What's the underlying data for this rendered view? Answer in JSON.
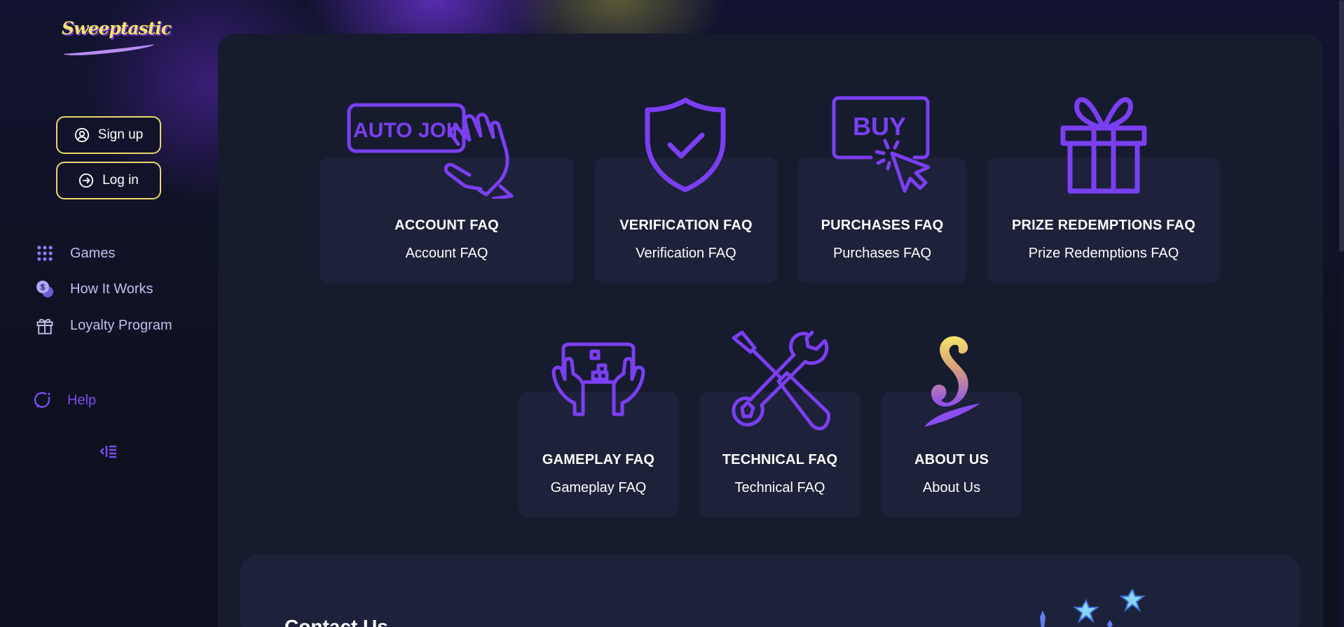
{
  "brand": {
    "name": "Sweeptastic"
  },
  "auth": {
    "signup_label": "Sign up",
    "login_label": "Log in"
  },
  "nav": {
    "items": [
      {
        "label": "Games",
        "icon": "grid-icon"
      },
      {
        "label": "How It Works",
        "icon": "coins-icon"
      },
      {
        "label": "Loyalty Program",
        "icon": "gift-icon"
      }
    ],
    "help": {
      "label": "Help",
      "icon": "help-bubble-icon"
    }
  },
  "faq": {
    "cards": [
      {
        "title": "ACCOUNT FAQ",
        "subtitle": "Account FAQ",
        "icon": "auto-join-hand-icon",
        "icon_text": "AUTO JOIN"
      },
      {
        "title": "VERIFICATION FAQ",
        "subtitle": "Verification FAQ",
        "icon": "shield-check-icon"
      },
      {
        "title": "PURCHASES FAQ",
        "subtitle": "Purchases FAQ",
        "icon": "buy-click-icon",
        "icon_text": "BUY"
      },
      {
        "title": "PRIZE REDEMPTIONS FAQ",
        "subtitle": "Prize Redemptions FAQ",
        "icon": "gift-box-icon"
      },
      {
        "title": "GAMEPLAY FAQ",
        "subtitle": "Gameplay FAQ",
        "icon": "game-controller-icon"
      },
      {
        "title": "TECHNICAL FAQ",
        "subtitle": "Technical FAQ",
        "icon": "tools-icon"
      },
      {
        "title": "ABOUT US",
        "subtitle": "About Us",
        "icon": "sweeptastic-s-logo-icon"
      }
    ]
  },
  "contact": {
    "title": "Contact Us"
  },
  "colors": {
    "accent": "#7b3ff2",
    "gold": "#f2e46a",
    "card_bg": "#1d2139",
    "panel_bg": "#161b2e",
    "page_bg": "#0f1120"
  }
}
